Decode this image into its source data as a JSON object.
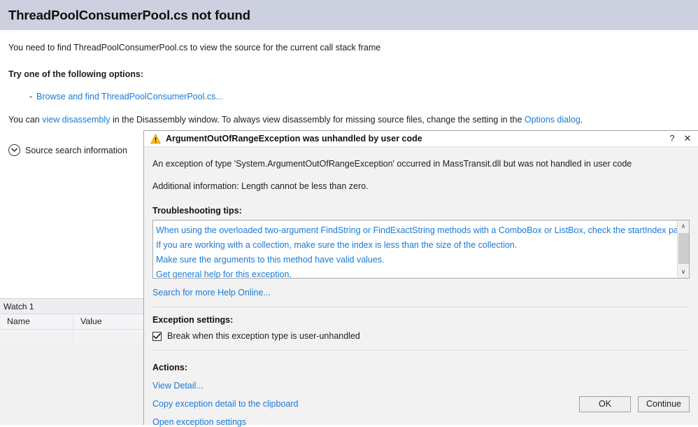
{
  "page": {
    "title": "ThreadPoolConsumerPool.cs not found",
    "intro": "You need to find ThreadPoolConsumerPool.cs to view the source for the current call stack frame",
    "options_heading": "Try one of the following options:",
    "option_dash": "-",
    "option_link": "Browse and find ThreadPoolConsumerPool.cs...",
    "disasm_prefix": "You can ",
    "disasm_link": "view disassembly",
    "disasm_middle": " in the Disassembly window. To always view disassembly for missing source files, change the setting in the ",
    "disasm_link2": "Options dialog",
    "disasm_suffix": ".",
    "source_search_label": "Source search information",
    "expander_icon": "chevron-down-circle-icon",
    "header_color": "#cdd0de",
    "link_color": "#1a7ad4"
  },
  "watch": {
    "tab_label": "Watch 1",
    "columns": [
      "Name",
      "Value"
    ],
    "rows": []
  },
  "dialog": {
    "icon": "warning-triangle-icon",
    "title": "ArgumentOutOfRangeException was unhandled by user code",
    "help_button": "?",
    "close_button": "✕",
    "message": "An exception of type 'System.ArgumentOutOfRangeException' occurred in MassTransit.dll but was not handled in user code",
    "additional_info": "Additional information: Length cannot be less than zero.",
    "tips_heading": "Troubleshooting tips:",
    "tips": [
      "When using the overloaded two-argument FindString or FindExactString methods with a ComboBox or ListBox, check the startIndex parameter.",
      "If you are working with a collection, make sure the index is less than the size of the collection.",
      "Make sure the arguments to this method have valid values.",
      "Get general help for this exception."
    ],
    "scroll_up": "∧",
    "scroll_down": "∨",
    "search_online": "Search for more Help Online...",
    "settings_heading": "Exception settings:",
    "settings_checkbox_label": "Break when this exception type is user-unhandled",
    "settings_checkbox_checked": true,
    "actions_heading": "Actions:",
    "actions": [
      "View Detail...",
      "Copy exception detail to the clipboard",
      "Open exception settings"
    ],
    "buttons": [
      "OK",
      "Continue"
    ],
    "warning_color": "#ffc723"
  }
}
